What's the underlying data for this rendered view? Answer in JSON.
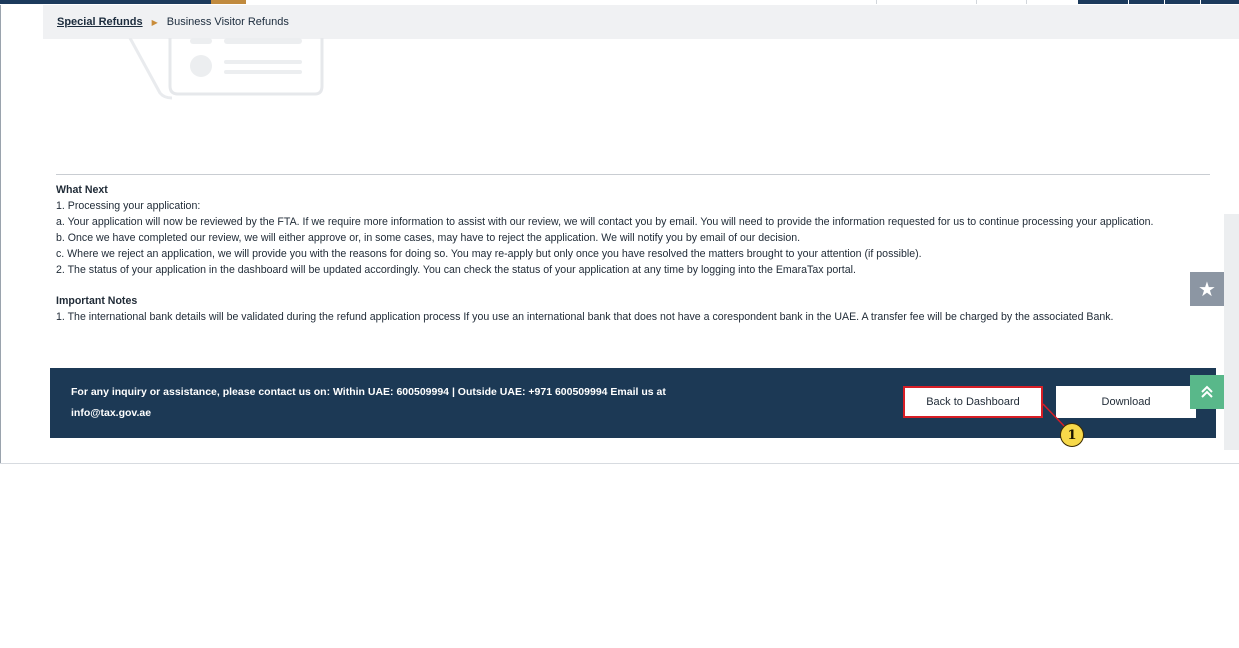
{
  "breadcrumb": {
    "parent": "Special Refunds",
    "current": "Business Visitor Refunds"
  },
  "what_next": {
    "title": "What Next",
    "lines": [
      "1. Processing your application:",
      " a. Your application will now be reviewed by the FTA. If we require more information to assist with our review, we will contact you by email. You will need to provide the information requested for us to continue processing your application.",
      " b. Once we have completed our review, we will either approve or, in some cases, may have to reject the application. We will notify you by email of our decision.",
      " c. Where we reject an application, we will provide you with the reasons for doing so. You may re-apply but only once you have resolved the matters brought to your attention (if possible).",
      "2. The status of your application in the dashboard will be updated accordingly. You can check the status of your application at any time by logging into the EmaraTax portal."
    ]
  },
  "important_notes": {
    "title": "Important Notes",
    "lines": [
      " 1. The international bank details will be validated during the refund application process If you use an international bank that does not have a corespondent bank in the UAE. A transfer fee will be charged by the associated Bank."
    ]
  },
  "footer": {
    "contact_line1": "For any inquiry or assistance, please contact us on: Within UAE: 600509994 | Outside UAE: +971 600509994 Email us at",
    "contact_line2": "info@tax.gov.ae",
    "back_button": "Back to Dashboard",
    "download_button": "Download"
  },
  "callout": {
    "number": "1"
  },
  "icons": {
    "breadcrumb_separator": "triangle-right-icon",
    "favorite": "star-icon",
    "scroll_top": "double-chevron-up-icon"
  },
  "colors": {
    "footer_bg": "#1c3955",
    "highlight_border": "#d71e26",
    "callout_fill": "#f7d94a",
    "accent_gold": "#c08a3e"
  }
}
